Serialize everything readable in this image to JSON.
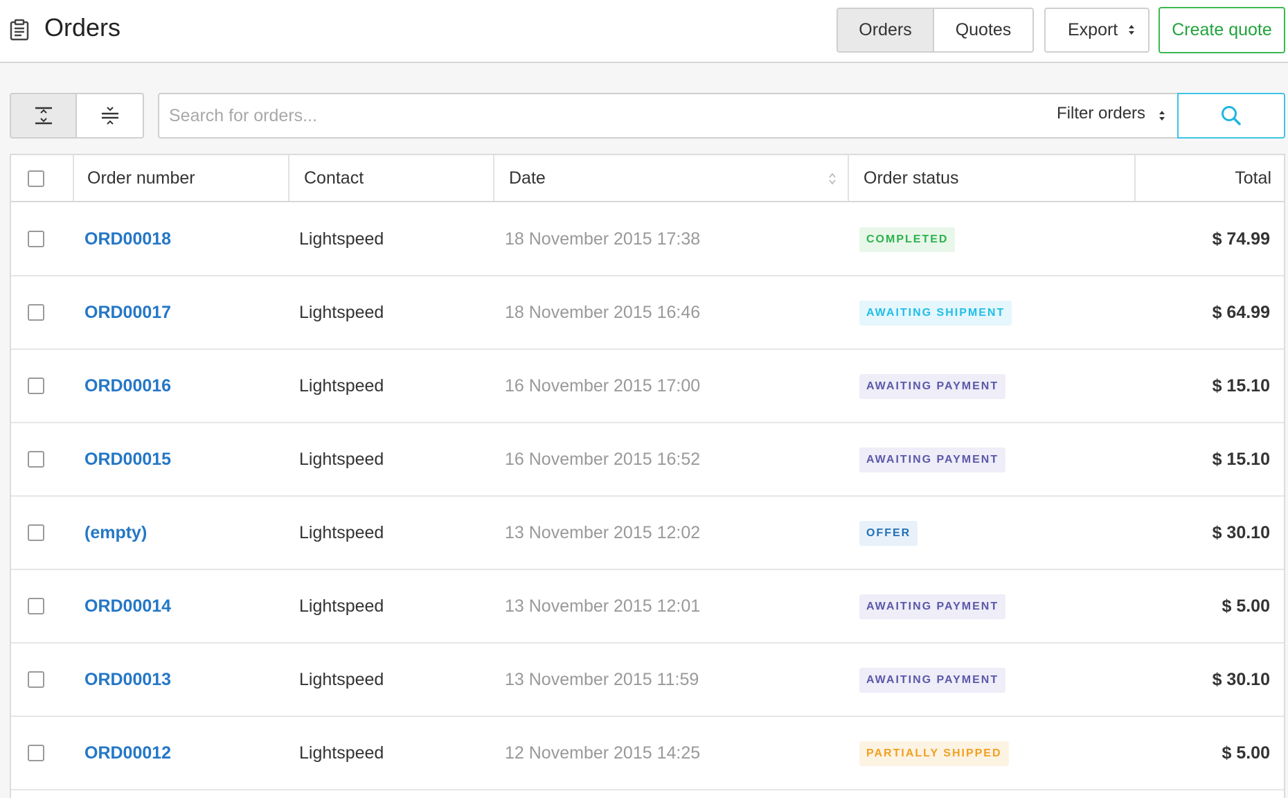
{
  "header": {
    "title": "Orders",
    "page_icon": "clipboard-icon",
    "tabs": [
      {
        "label": "Orders",
        "active": true
      },
      {
        "label": "Quotes",
        "active": false
      }
    ],
    "export_label": "Export",
    "create_quote_label": "Create quote"
  },
  "toolbar": {
    "view_toggle_icons": [
      "expanded-rows-icon",
      "compact-rows-icon"
    ],
    "search_placeholder": "Search for orders...",
    "filter_label": "Filter orders",
    "search_icon": "search-icon"
  },
  "table": {
    "columns": {
      "order_number": "Order number",
      "contact": "Contact",
      "date": "Date",
      "status": "Order status",
      "total": "Total"
    },
    "rows": [
      {
        "order": "ORD00018",
        "contact": "Lightspeed",
        "date": "18 November 2015 17:38",
        "status": "COMPLETED",
        "status_kind": "completed",
        "total": "$ 74.99"
      },
      {
        "order": "ORD00017",
        "contact": "Lightspeed",
        "date": "18 November 2015 16:46",
        "status": "AWAITING SHIPMENT",
        "status_kind": "shipment",
        "total": "$ 64.99"
      },
      {
        "order": "ORD00016",
        "contact": "Lightspeed",
        "date": "16 November 2015 17:00",
        "status": "AWAITING PAYMENT",
        "status_kind": "payment",
        "total": "$ 15.10"
      },
      {
        "order": "ORD00015",
        "contact": "Lightspeed",
        "date": "16 November 2015 16:52",
        "status": "AWAITING PAYMENT",
        "status_kind": "payment",
        "total": "$ 15.10"
      },
      {
        "order": "(empty)",
        "contact": "Lightspeed",
        "date": "13 November 2015 12:02",
        "status": "OFFER",
        "status_kind": "offer",
        "total": "$ 30.10"
      },
      {
        "order": "ORD00014",
        "contact": "Lightspeed",
        "date": "13 November 2015 12:01",
        "status": "AWAITING PAYMENT",
        "status_kind": "payment",
        "total": "$ 5.00"
      },
      {
        "order": "ORD00013",
        "contact": "Lightspeed",
        "date": "13 November 2015 11:59",
        "status": "AWAITING PAYMENT",
        "status_kind": "payment",
        "total": "$ 30.10"
      },
      {
        "order": "ORD00012",
        "contact": "Lightspeed",
        "date": "12 November 2015 14:25",
        "status": "PARTIALLY SHIPPED",
        "status_kind": "partial",
        "total": "$ 5.00"
      }
    ]
  },
  "colors": {
    "link": "#2477c6",
    "create_quote": "#22a33c",
    "search_accent": "#3cc4e6",
    "status": {
      "completed": {
        "fg": "#2bb24c",
        "bg": "#e8f7ea"
      },
      "shipment": {
        "fg": "#21bde8",
        "bg": "#e5f7fc"
      },
      "payment": {
        "fg": "#5b58a8",
        "bg": "#eeedf8"
      },
      "offer": {
        "fg": "#2070b8",
        "bg": "#e8f1fa"
      },
      "partial": {
        "fg": "#f0a020",
        "bg": "#fdf3e3"
      }
    }
  }
}
